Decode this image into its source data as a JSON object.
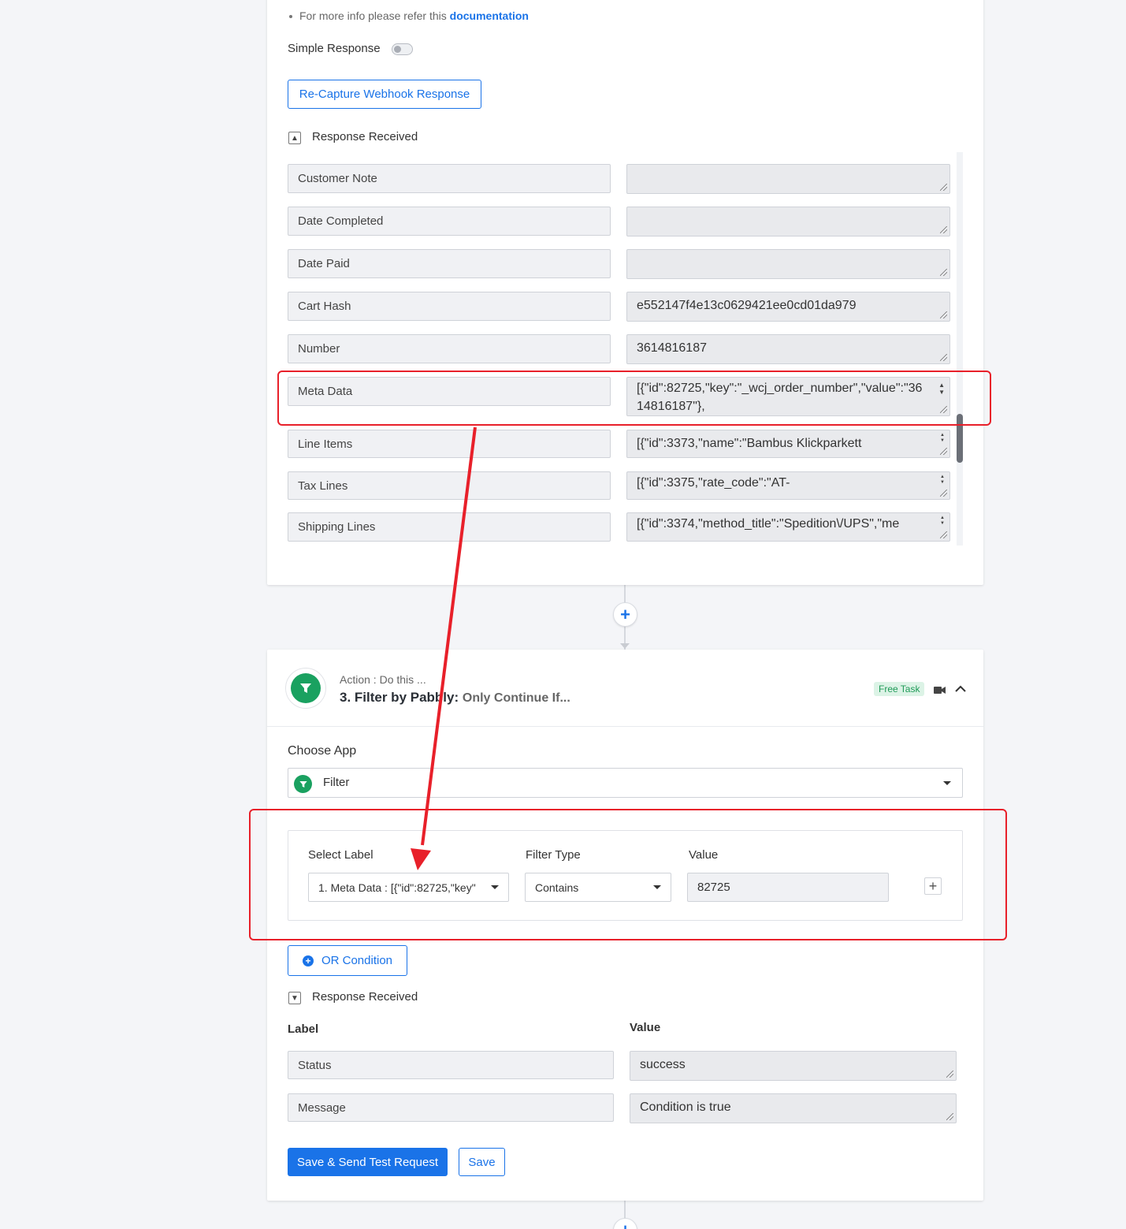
{
  "step1": {
    "doc_text": "For more info please refer this ",
    "doc_link": "documentation",
    "simple_response_label": "Simple Response",
    "recapture_button": "Re-Capture Webhook Response",
    "response_received": "Response Received",
    "fields": [
      {
        "label": "Customer Note",
        "value": ""
      },
      {
        "label": "Date Completed",
        "value": ""
      },
      {
        "label": "Date Paid",
        "value": ""
      },
      {
        "label": "Cart Hash",
        "value": "e552147f4e13c0629421ee0cd01da979"
      },
      {
        "label": "Number",
        "value": "3614816187"
      },
      {
        "label": "Meta Data",
        "value": "[{\"id\":82725,\"key\":\"_wcj_order_number\",\"value\":\"3614816187\"},"
      },
      {
        "label": "Line Items",
        "value": "[{\"id\":3373,\"name\":\"Bambus Klickparkett"
      },
      {
        "label": "Tax Lines",
        "value": "[{\"id\":3375,\"rate_code\":\"AT-"
      },
      {
        "label": "Shipping Lines",
        "value": "[{\"id\":3374,\"method_title\":\"Spedition\\/UPS\",\"me"
      }
    ]
  },
  "step2": {
    "action_sub": "Action : Do this ...",
    "action_title": "3. Filter by Pabbly:",
    "action_title_muted": "Only Continue If...",
    "free_task": "Free Task",
    "choose_app_label": "Choose App",
    "selected_app": "Filter",
    "filter": {
      "select_label_head": "Select Label",
      "filter_type_head": "Filter Type",
      "value_head": "Value",
      "selected_label": "1. Meta Data : [{\"id\":82725,\"key\"",
      "filter_type": "Contains",
      "value": "82725"
    },
    "or_condition": "OR Condition",
    "response_received": "Response Received",
    "label_head": "Label",
    "value_head": "Value",
    "results": [
      {
        "label": "Status",
        "value": "success"
      },
      {
        "label": "Message",
        "value": "Condition is true"
      }
    ],
    "save_send_button": "Save & Send Test Request",
    "save_button": "Save"
  },
  "colors": {
    "accent": "#1a73e8",
    "filter_green": "#1aa160",
    "highlight_red": "#e8202a"
  }
}
